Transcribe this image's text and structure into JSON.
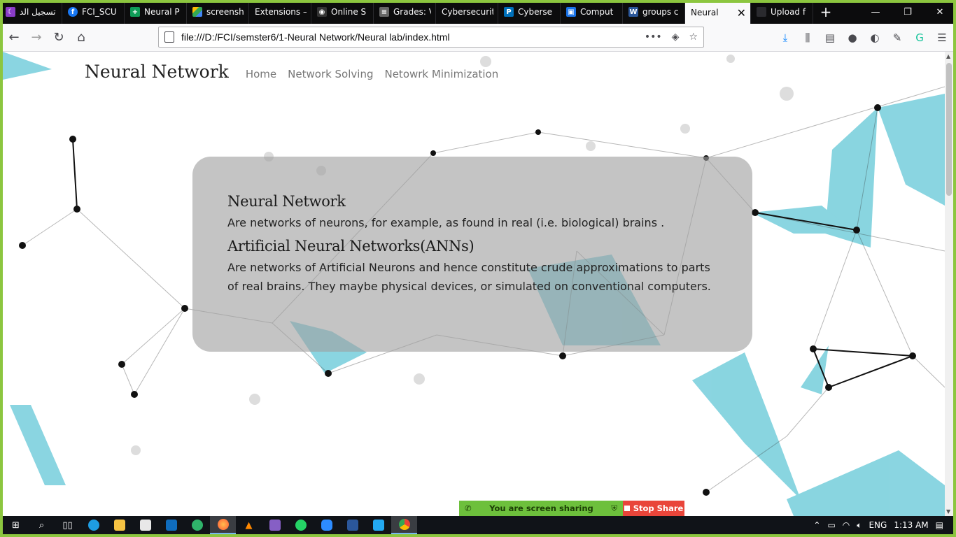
{
  "browser": {
    "tabs": [
      {
        "label": "تسجيل الد",
        "icon": "moon-icon",
        "color": "#8a3cc8"
      },
      {
        "label": "FCI_SCU",
        "icon": "facebook-icon",
        "color": "#1877f2"
      },
      {
        "label": "Neural P",
        "icon": "sheets-icon",
        "color": "#0f9d58"
      },
      {
        "label": "screensh",
        "icon": "drive-icon",
        "color": "#fbbc04"
      },
      {
        "label": "Extensions –",
        "icon": "",
        "color": ""
      },
      {
        "label": "Online S",
        "icon": "eye-icon",
        "color": "#333333"
      },
      {
        "label": "Grades: V",
        "icon": "grades-icon",
        "color": "#666666"
      },
      {
        "label": "Cybersecurit",
        "icon": "",
        "color": ""
      },
      {
        "label": "Cyberse",
        "icon": "paypal-icon",
        "color": "#0070ba"
      },
      {
        "label": "Comput",
        "icon": "contact-icon",
        "color": "#1a73e8"
      },
      {
        "label": "groups c",
        "icon": "word-icon",
        "color": "#2b579a"
      },
      {
        "label": "Neural",
        "icon": "",
        "color": "",
        "active": true
      },
      {
        "label": "Upload f",
        "icon": "",
        "color": ""
      }
    ],
    "url": "file:///D:/FCI/semster6/1-Neural Network/Neural lab/index.html",
    "url_actions": "•••"
  },
  "site": {
    "brand": "Neural Network",
    "nav": [
      "Home",
      "Network Solving",
      "Netowrk Minimization"
    ]
  },
  "content": {
    "heading1": "Neural Network",
    "text1": "Are networks of neurons, for example, as found in real (i.e. biological) brains .",
    "heading2": "Artificial Neural Networks(ANNs)",
    "text2": "Are networks of Artificial Neurons and hence constitute crude approximations to parts of real brains. They maybe physical devices, or simulated on conventional computers."
  },
  "screenshare": {
    "message": "You are screen sharing",
    "stop_label": "Stop Share"
  },
  "taskbar": {
    "language": "ENG",
    "time": "1:13 AM"
  },
  "colors": {
    "accent_teal": "#2ab3c8",
    "share_green": "#6dc03c",
    "stop_red": "#e9453a",
    "frame_green": "#8cc63f"
  }
}
